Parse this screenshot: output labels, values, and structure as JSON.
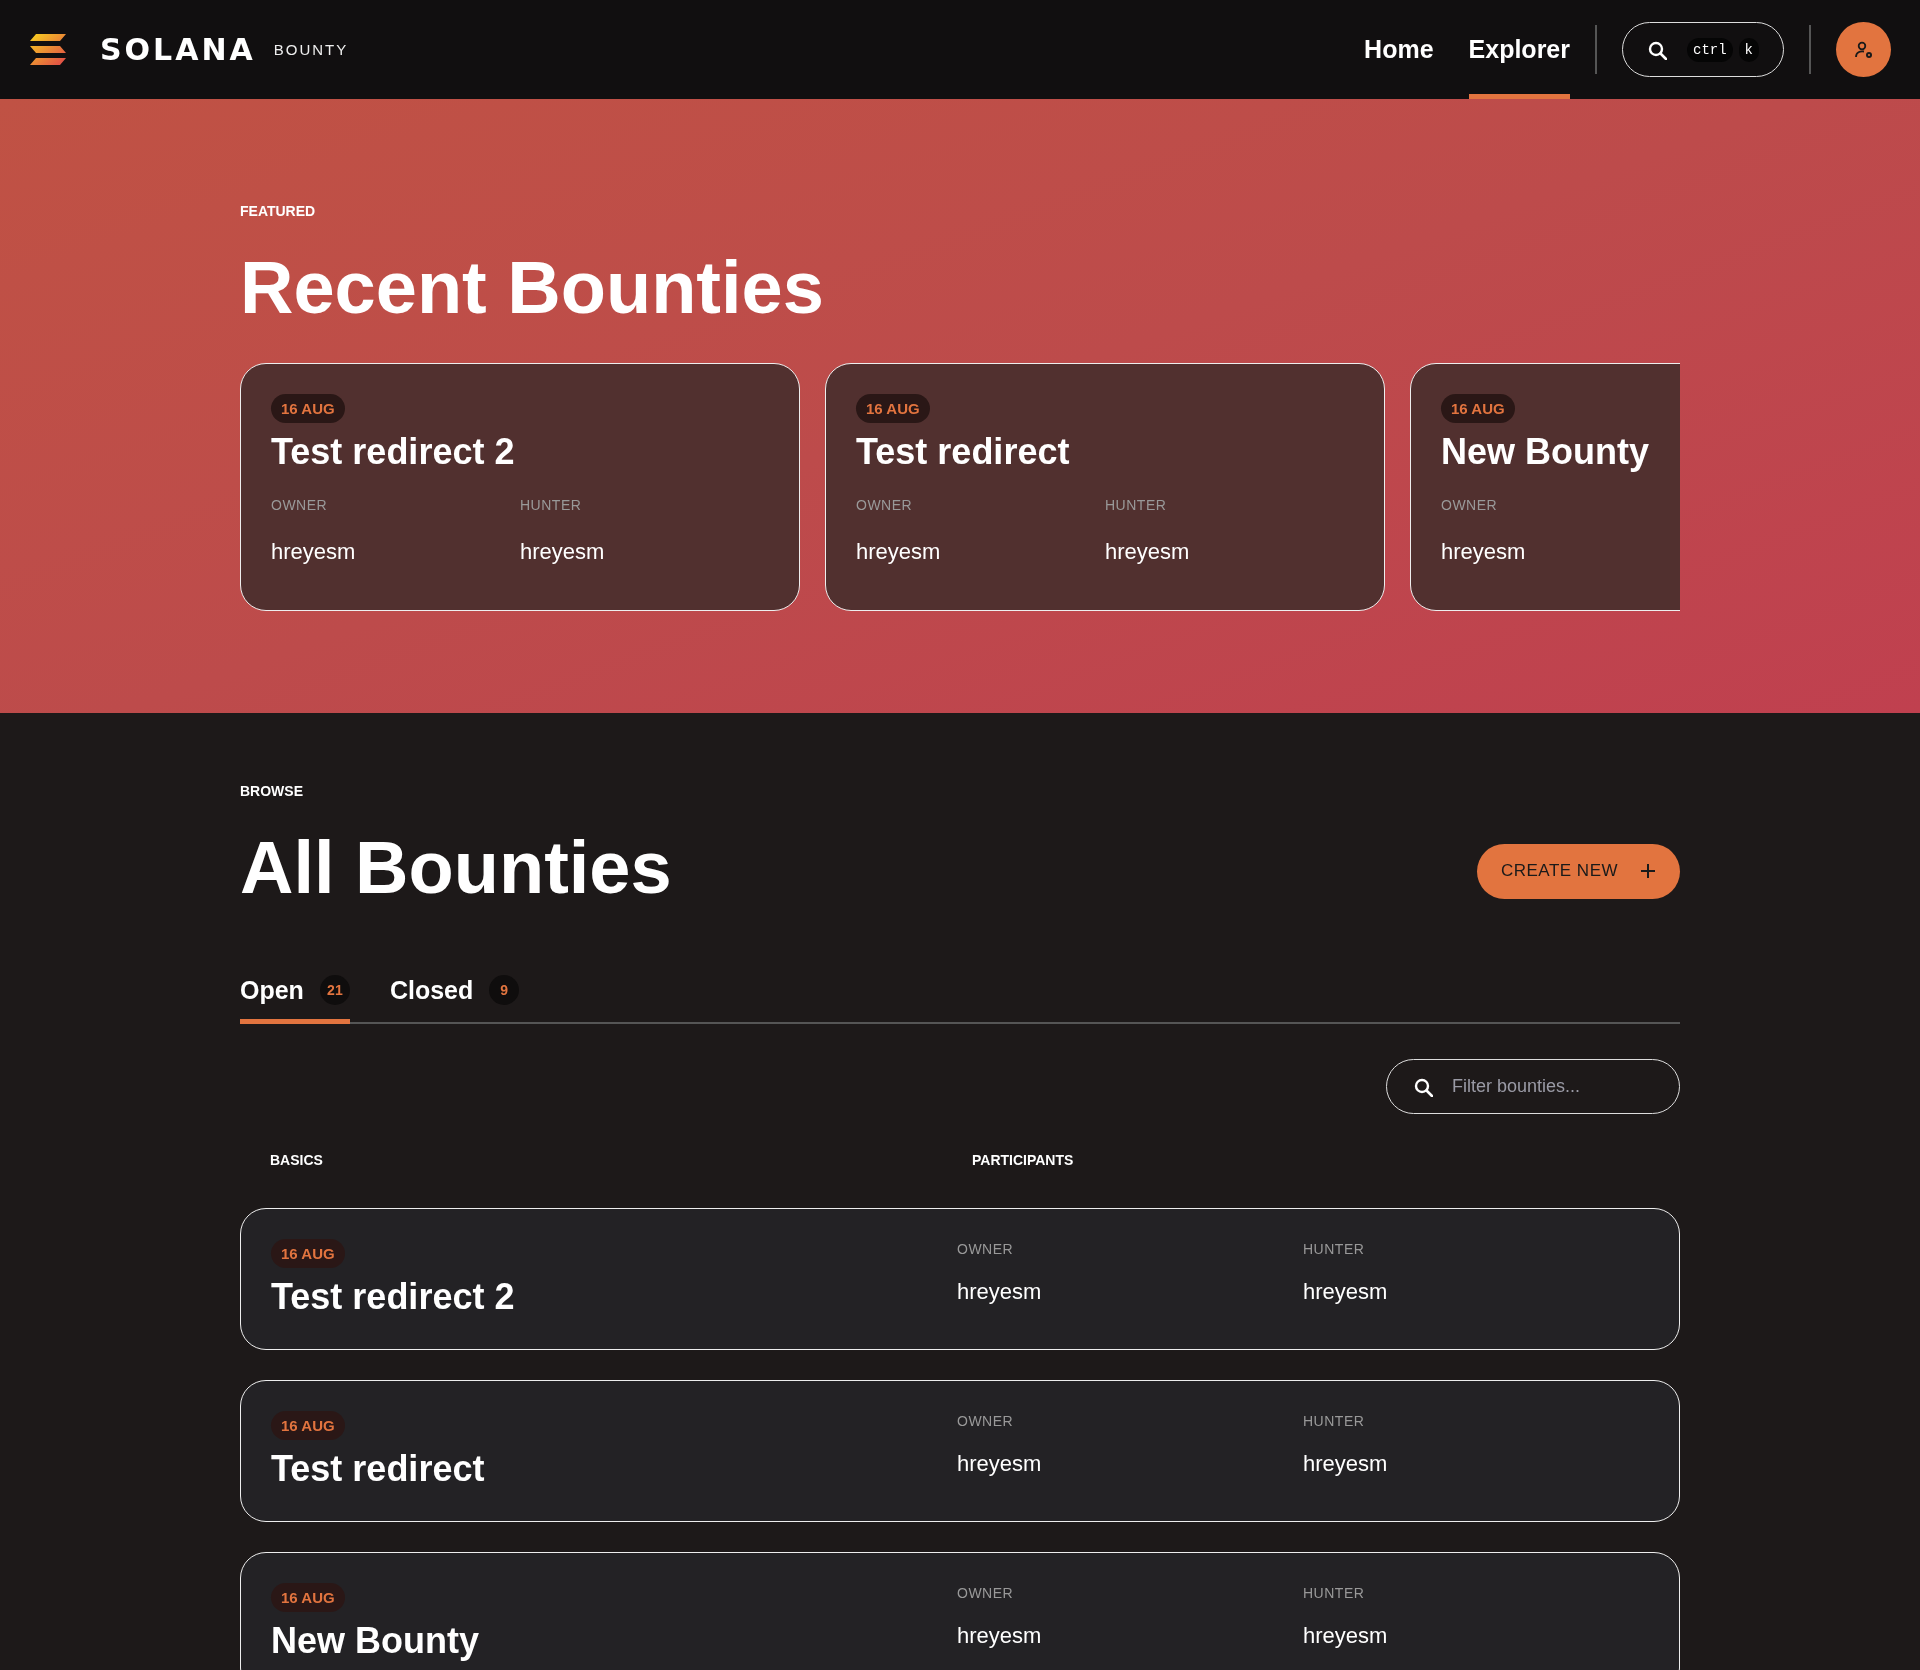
{
  "header": {
    "logo_text": "SOLANA",
    "logo_subtitle": "BOUNTY",
    "nav": [
      {
        "label": "Home",
        "selected": false
      },
      {
        "label": "Explorer",
        "selected": true
      }
    ],
    "search_shortcut": [
      "ctrl",
      "k"
    ]
  },
  "featured": {
    "eyebrow": "FEATURED",
    "title": "Recent Bounties",
    "cards": [
      {
        "date": "16 AUG",
        "title": "Test redirect 2",
        "owner_label": "OWNER",
        "owner": "hreyesm",
        "hunter_label": "HUNTER",
        "hunter": "hreyesm"
      },
      {
        "date": "16 AUG",
        "title": "Test redirect",
        "owner_label": "OWNER",
        "owner": "hreyesm",
        "hunter_label": "HUNTER",
        "hunter": "hreyesm"
      },
      {
        "date": "16 AUG",
        "title": "New Bounty",
        "owner_label": "OWNER",
        "owner": "hreyesm"
      }
    ]
  },
  "browse": {
    "eyebrow": "BROWSE",
    "title": "All Bounties",
    "create_button": "CREATE NEW",
    "tabs": [
      {
        "label": "Open",
        "count": "21",
        "selected": true
      },
      {
        "label": "Closed",
        "count": "9",
        "selected": false
      }
    ],
    "filter": {
      "placeholder": "Filter bounties..."
    },
    "columns": [
      "BASICS",
      "PARTICIPANTS"
    ],
    "rows": [
      {
        "date": "16 AUG",
        "title": "Test redirect 2",
        "owner_label": "OWNER",
        "owner": "hreyesm",
        "hunter_label": "HUNTER",
        "hunter": "hreyesm"
      },
      {
        "date": "16 AUG",
        "title": "Test redirect",
        "owner_label": "OWNER",
        "owner": "hreyesm",
        "hunter_label": "HUNTER",
        "hunter": "hreyesm"
      },
      {
        "date": "16 AUG",
        "title": "New Bounty",
        "owner_label": "OWNER",
        "owner": "hreyesm",
        "hunter_label": "HUNTER",
        "hunter": "hreyesm"
      }
    ]
  }
}
